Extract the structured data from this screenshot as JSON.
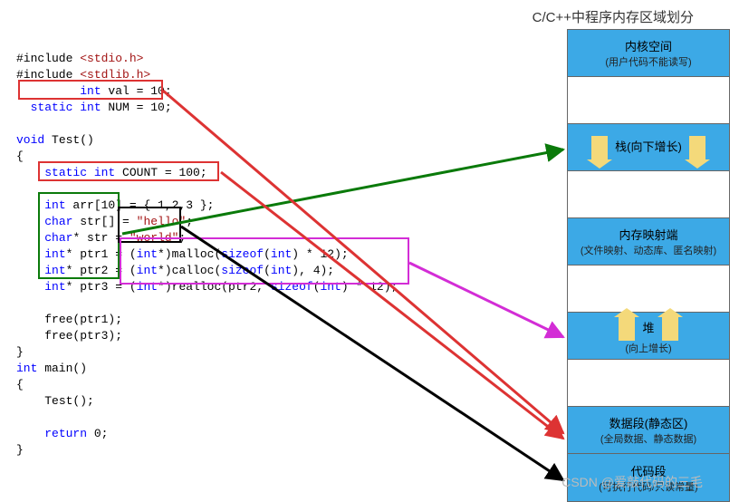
{
  "title": "C/C++中程序内存区域划分",
  "code": {
    "l1": "#include ",
    "h1": "<stdio.h>",
    "l2": "#include ",
    "h2": "<stdlib.h>",
    "l3a": "int",
    "l3b": " val = 10;",
    "l4a": "static int",
    "l4b": " NUM = 10;",
    "l5a": "void",
    "l5b": " Test()",
    "l6": "{",
    "l7a": "static int",
    "l7b": " COUNT = 100;",
    "l8a": "int",
    "l8b": " arr[10] = { 1,2,3 };",
    "l9a": "char",
    "l9b": " str[] = ",
    "l9c": "\"hello\"",
    "l9d": ";",
    "l10a": "char",
    "l10b": "* str = ",
    "l10c": "\"world\"",
    "l10d": ";",
    "l11a": "int",
    "l11b": "* ptr1 = (",
    "l11c": "int",
    "l11d": "*)malloc(",
    "l11e": "sizeof",
    "l11f": "(",
    "l11g": "int",
    "l11h": ") * 12);",
    "l12a": "int",
    "l12b": "* ptr2 = (",
    "l12c": "int",
    "l12d": "*)calloc(",
    "l12e": "sizeof",
    "l12f": "(",
    "l12g": "int",
    "l12h": "), 4);",
    "l13a": "int",
    "l13b": "* ptr3 = (",
    "l13c": "int",
    "l13d": "*)realloc(ptr2, ",
    "l13e": "sizeof",
    "l13f": "(",
    "l13g": "int",
    "l13h": ") * 12);",
    "l14": "free(ptr1);",
    "l15": "free(ptr3);",
    "l16": "}",
    "l17a": "int",
    "l17b": " main()",
    "l18": "{",
    "l19": "Test();",
    "l20a": "return",
    "l20b": " 0;",
    "l21": "}"
  },
  "memory": {
    "kernel": "内核空间",
    "kernel_sub": "(用户代码不能读写)",
    "stack": "栈(向下增长)",
    "mmap": "内存映射端",
    "mmap_sub": "(文件映射、动态库、匿名映射)",
    "heap": "堆",
    "heap_sub": "(向上增长)",
    "data": "数据段(静态区)",
    "data_sub": "(全局数据、静态数据)",
    "text": "代码段",
    "text_sub": "(可执行代码/只读常量)"
  },
  "watermark": "CSDN @爱敲代码的三毛"
}
